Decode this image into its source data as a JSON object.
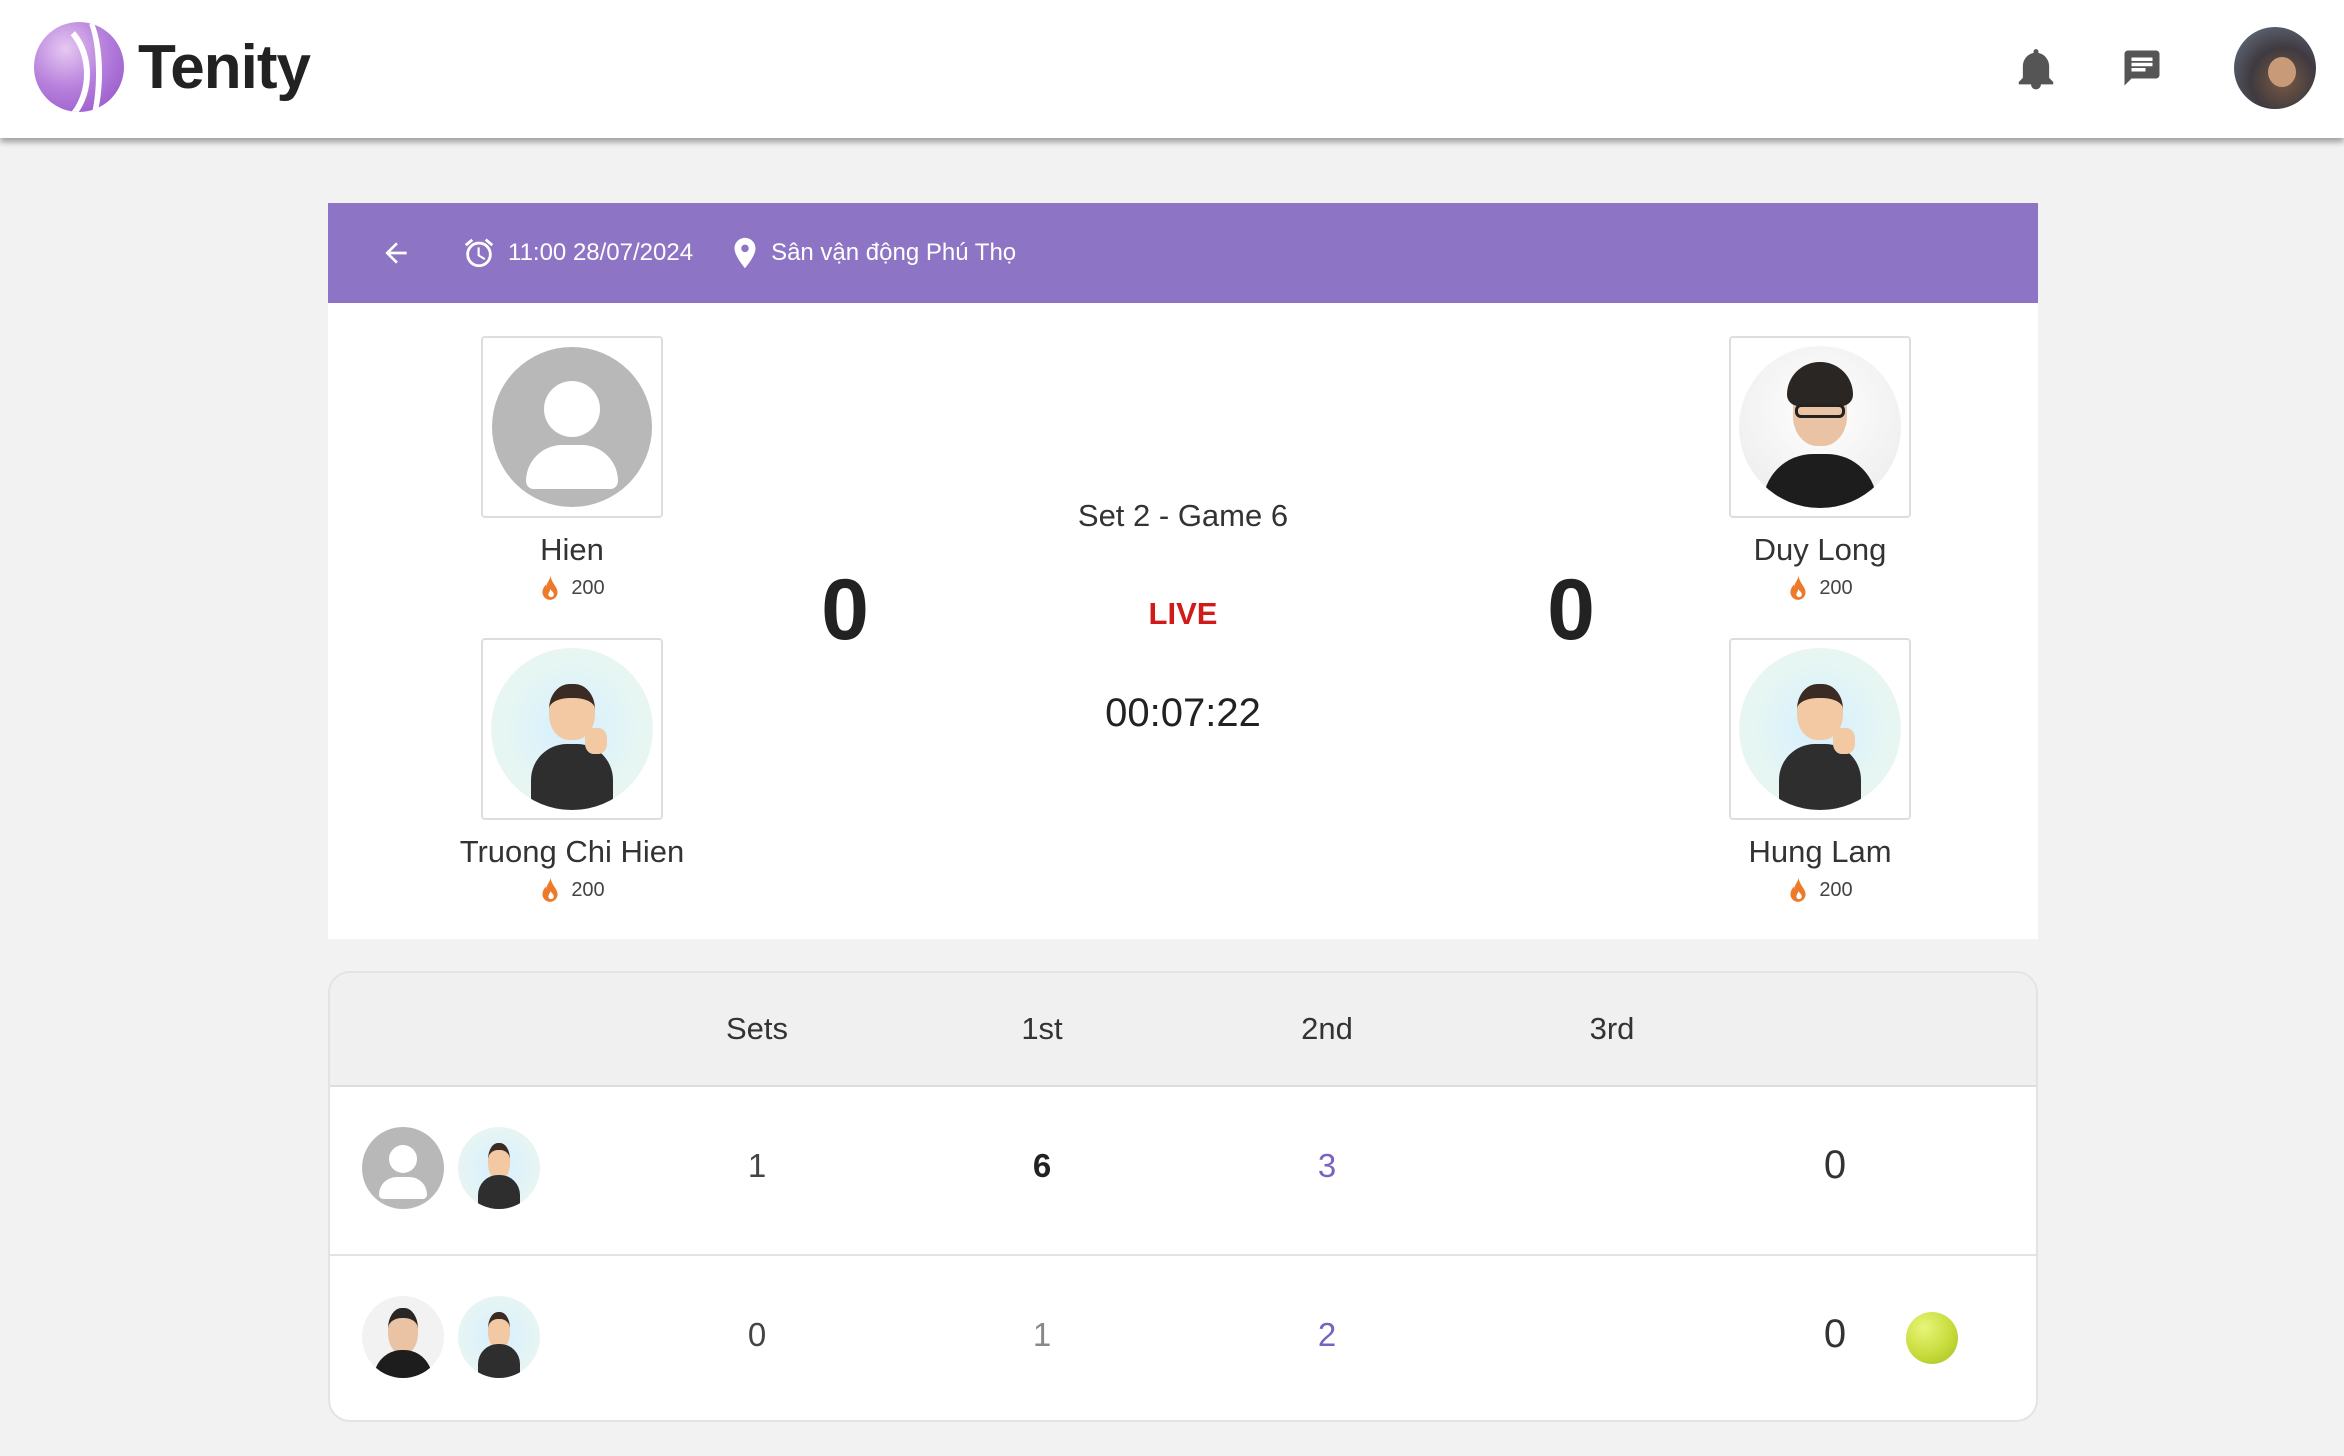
{
  "app": {
    "name": "Tenity"
  },
  "colors": {
    "header_purple": "#8e74c4",
    "live_red": "#d11a1a",
    "accent_purple": "#7a63c0"
  },
  "header": {
    "icons": [
      "logo-icon",
      "bell-icon",
      "chat-icon",
      "user-avatar"
    ]
  },
  "match": {
    "datetime": "11:00 28/07/2024",
    "location": "Sân vận động Phú Thọ",
    "set_game": "Set 2 - Game 6",
    "status": "LIVE",
    "elapsed": "00:07:22",
    "team_a": {
      "score": "0",
      "players": [
        {
          "name": "Hien",
          "points": "200",
          "avatar": "default-avatar-icon"
        },
        {
          "name": "Truong Chi Hien",
          "points": "200",
          "avatar": "cartoon-avatar"
        }
      ]
    },
    "team_b": {
      "score": "0",
      "players": [
        {
          "name": "Duy Long",
          "points": "200",
          "avatar": "photo-avatar"
        },
        {
          "name": "Hung Lam",
          "points": "200",
          "avatar": "cartoon-avatar"
        }
      ]
    }
  },
  "scoreboard": {
    "headers": [
      "Sets",
      "1st",
      "2nd",
      "3rd"
    ],
    "rows": [
      {
        "sets": "1",
        "first": "6",
        "second": "3",
        "third": "",
        "points": "0",
        "serving": false
      },
      {
        "sets": "0",
        "first": "1",
        "second": "2",
        "third": "",
        "points": "0",
        "serving": true
      }
    ]
  }
}
